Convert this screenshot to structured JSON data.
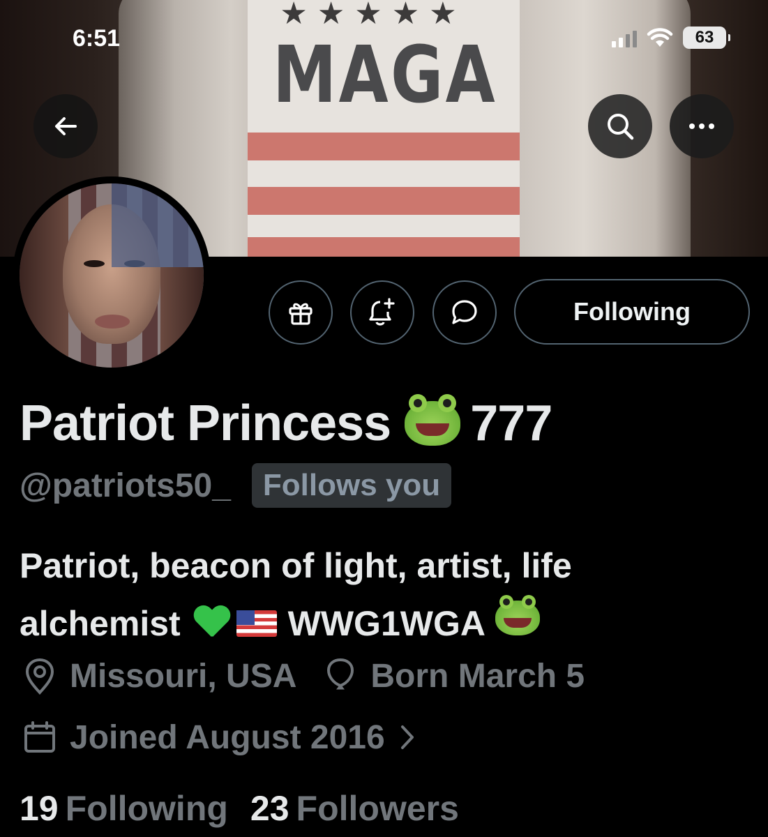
{
  "status_bar": {
    "time": "6:51",
    "battery": "63"
  },
  "banner": {
    "shirt_text": "MAGA"
  },
  "header": {
    "back_icon": "arrow-left-icon",
    "search_icon": "search-icon",
    "more_icon": "more-horizontal-icon"
  },
  "actions": {
    "gift_icon": "gift-icon",
    "notify_icon": "bell-plus-icon",
    "message_icon": "chat-bubble-icon",
    "following_label": "Following"
  },
  "profile": {
    "name": "Patriot Princess",
    "name_suffix": "777",
    "handle": "@patriots50_",
    "follows_you": "Follows you",
    "bio_line1": "Patriot, beacon of light, artist, life",
    "bio_line2_start": "alchemist",
    "bio_line2_end": "WWG1WGA",
    "location": "Missouri, USA",
    "birthday": "Born March 5",
    "joined": "Joined August 2016"
  },
  "stats": {
    "following_count": "19",
    "following_label": "Following",
    "followers_count": "23",
    "followers_label": "Followers"
  },
  "colors": {
    "background": "#000000",
    "text_primary": "#e7e9ea",
    "text_secondary": "#71767b",
    "border": "#536471"
  }
}
